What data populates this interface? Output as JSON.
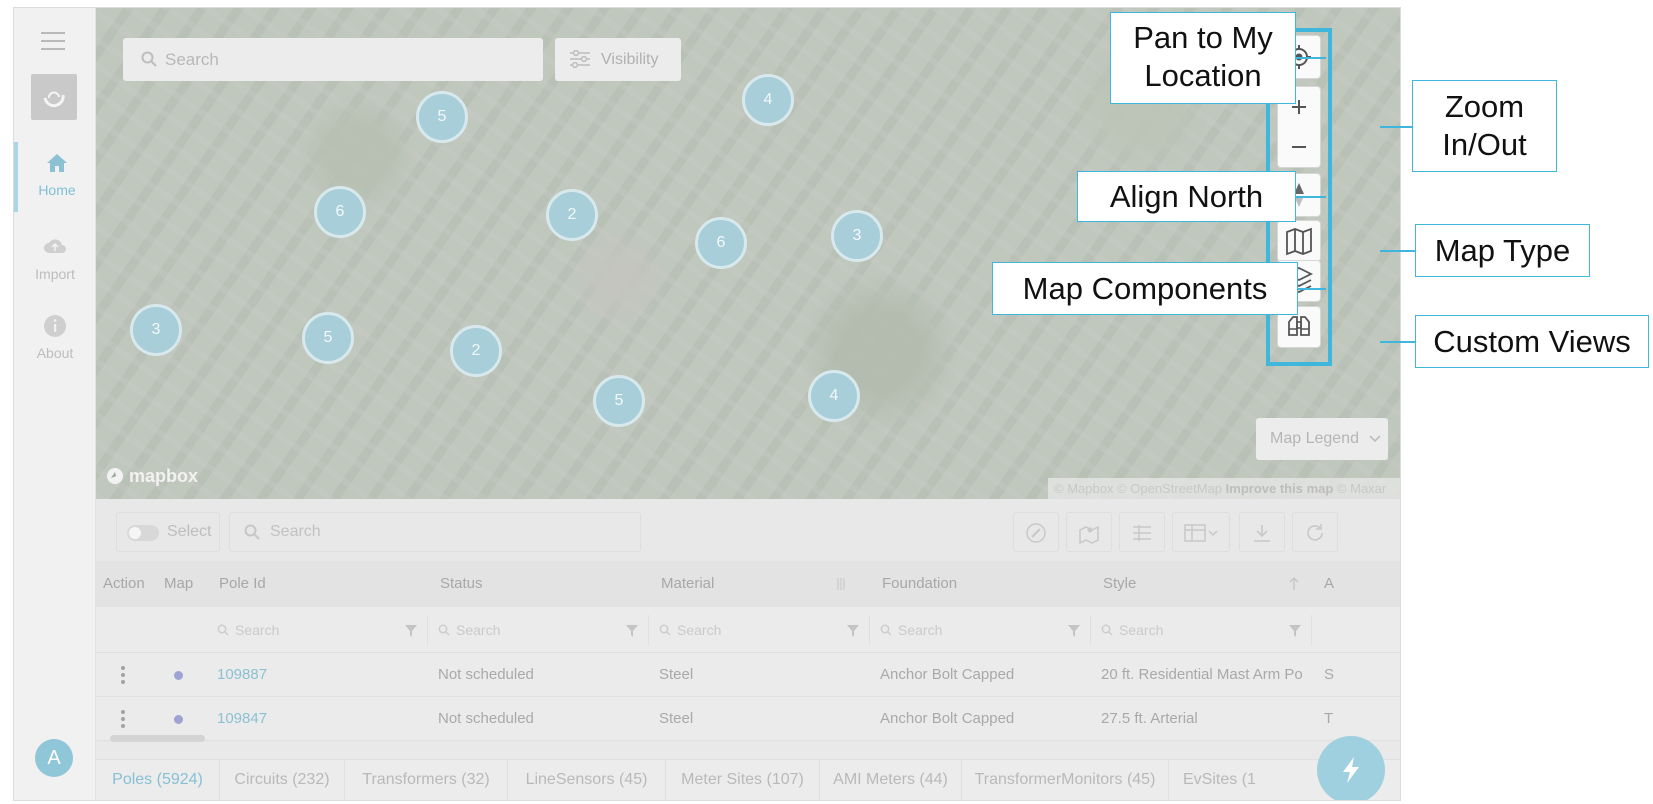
{
  "sidebar": {
    "items": [
      {
        "label": "Home",
        "icon": "home-icon",
        "active": true
      },
      {
        "label": "Import",
        "icon": "cloud-upload-icon",
        "active": false
      },
      {
        "label": "About",
        "icon": "info-icon",
        "active": false
      }
    ],
    "avatar": "A"
  },
  "map": {
    "search_placeholder": "Search",
    "visibility_label": "Visibility",
    "clusters": [
      "5",
      "4",
      "6",
      "2",
      "6",
      "3",
      "3",
      "5",
      "2",
      "5",
      "4"
    ],
    "legend_label": "Map Legend",
    "mapbox_logo": "mapbox",
    "attribution": "© Mapbox © OpenStreetMap",
    "attribution_link": "Improve this map",
    "attribution_suffix": "© Maxar"
  },
  "callouts": {
    "pan": "Pan to My Location",
    "zoom": "Zoom In/Out",
    "north": "Align  North",
    "type": "Map Type",
    "components": "Map Components",
    "custom": "Custom Views"
  },
  "table": {
    "select_label": "Select",
    "search_placeholder": "Search",
    "columns": [
      "Action",
      "Map",
      "Pole Id",
      "Status",
      "Material",
      "Foundation",
      "Style",
      "A"
    ],
    "filter_placeholder": "Search",
    "rows": [
      {
        "pole_id": "109887",
        "status": "Not scheduled",
        "material": "Steel",
        "foundation": "Anchor Bolt Capped",
        "style": "20 ft. Residential Mast Arm Po",
        "extra": "S"
      },
      {
        "pole_id": "109847",
        "status": "Not scheduled",
        "material": "Steel",
        "foundation": "Anchor Bolt Capped",
        "style": "27.5 ft. Arterial",
        "extra": "T"
      }
    ]
  },
  "tabs": [
    "Poles (5924)",
    "Circuits (232)",
    "Transformers (32)",
    "LineSensors (45)",
    "Meter Sites (107)",
    "AMI Meters (44)",
    "TransformerMonitors (45)",
    "EvSites (1"
  ],
  "colors": {
    "accent": "#3fb7dc",
    "cluster": "#a8cfd9",
    "link": "#8cc1d4"
  }
}
